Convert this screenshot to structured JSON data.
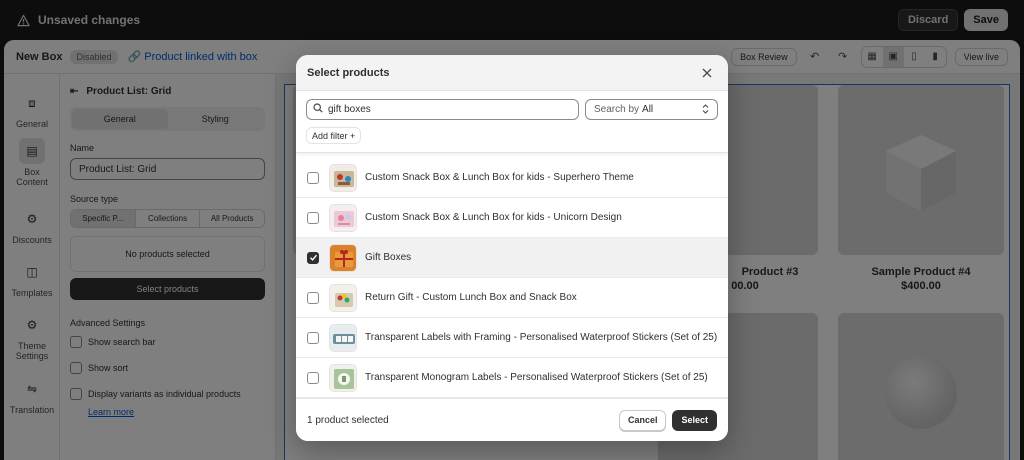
{
  "topbar": {
    "title": "Unsaved changes",
    "discard_label": "Discard",
    "save_label": "Save"
  },
  "editor": {
    "box_name": "New Box",
    "status_badge": "Disabled",
    "linked_label": "Product linked with box",
    "review_label": "Box Review",
    "view_live_label": "View live"
  },
  "rail": [
    {
      "label": "General",
      "icon": "cube-icon"
    },
    {
      "label": "Box Content",
      "icon": "list-icon"
    },
    {
      "label": "Discounts",
      "icon": "discount-icon"
    },
    {
      "label": "Templates",
      "icon": "template-icon"
    },
    {
      "label": "Theme Settings",
      "icon": "gear-icon"
    },
    {
      "label": "Translation",
      "icon": "translate-icon"
    }
  ],
  "panel": {
    "title": "Product List: Grid",
    "tabs": [
      "General",
      "Styling"
    ],
    "name_label": "Name",
    "name_value": "Product List: Grid",
    "source_label": "Source type",
    "source_options": [
      "Specific P...",
      "Collections",
      "All Products"
    ],
    "no_products": "No products selected",
    "select_products": "Select products",
    "advanced": "Advanced Settings",
    "show_search": "Show search bar",
    "show_sort": "Show sort",
    "display_variants": "Display variants as individual products",
    "learn_more": "Learn more"
  },
  "preview": {
    "p3_name": "Product #3",
    "p3_price": "00.00",
    "p4_name": "Sample Product #4",
    "p4_price": "$400.00"
  },
  "modal": {
    "title": "Select products",
    "search_value": "gift boxes",
    "search_by_label": "Search by",
    "search_by_value": "All",
    "add_filter": "Add filter +",
    "products": [
      {
        "name": "Custom Snack Box & Lunch Box for kids - Superhero Theme",
        "checked": false
      },
      {
        "name": "Custom Snack Box & Lunch Box for kids - Unicorn Design",
        "checked": false
      },
      {
        "name": "Gift Boxes",
        "checked": true
      },
      {
        "name": "Return Gift - Custom Lunch Box and Snack Box",
        "checked": false
      },
      {
        "name": "Transparent Labels with Framing - Personalised Waterproof Stickers (Set of 25)",
        "checked": false
      },
      {
        "name": "Transparent Monogram Labels - Personalised Waterproof Stickers (Set of 25)",
        "checked": false
      }
    ],
    "selected_count": "1 product selected",
    "cancel_label": "Cancel",
    "select_label": "Select"
  },
  "colors": {
    "primary": "#303030",
    "link": "#005bd3",
    "selection_frame": "#2c6ecb"
  }
}
